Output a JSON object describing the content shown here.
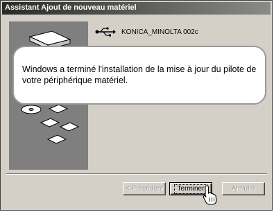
{
  "window": {
    "title": "Assistant Ajout de nouveau matériel"
  },
  "device": {
    "icon": "usb-icon",
    "name": "KONICA_MINOLTA 002c"
  },
  "message": {
    "text": "Windows a terminé l'installation de la mise à jour du pilote de votre périphérique matériel."
  },
  "buttons": {
    "previous": {
      "label": "< Précédent",
      "enabled": false
    },
    "finish": {
      "label": "Terminer",
      "enabled": true,
      "default": true
    },
    "cancel": {
      "label": "Annuler",
      "enabled": false
    }
  },
  "colors": {
    "dialog_bg": "#d4d0c8",
    "wizard_panel": "#7f7f7f",
    "title_gradient_start": "#2a2a2a",
    "title_gradient_end": "#8a8a8a"
  }
}
